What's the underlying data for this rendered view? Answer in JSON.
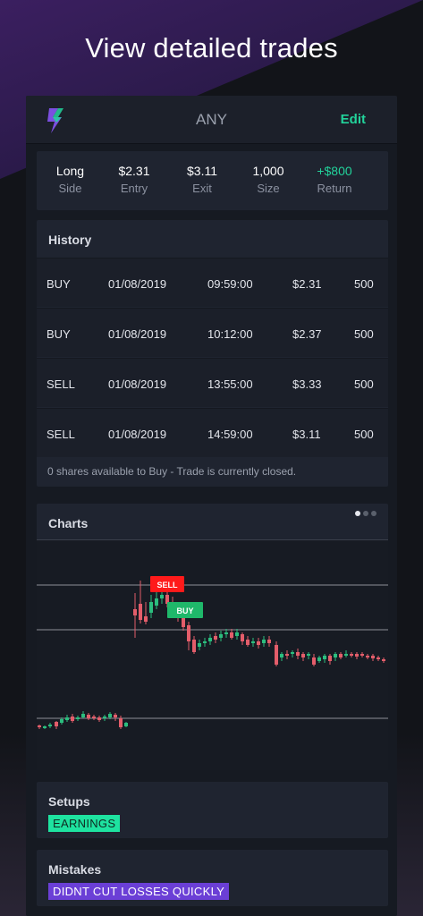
{
  "hero_title": "View detailed trades",
  "header": {
    "ticker": "ANY",
    "edit_label": "Edit"
  },
  "summary": [
    {
      "value": "Long",
      "label": "Side"
    },
    {
      "value": "$2.31",
      "label": "Entry"
    },
    {
      "value": "$3.11",
      "label": "Exit"
    },
    {
      "value": "1,000",
      "label": "Size"
    },
    {
      "value": "+$800",
      "label": "Return"
    }
  ],
  "history": {
    "title": "History",
    "rows": [
      {
        "side": "BUY",
        "date": "01/08/2019",
        "time": "09:59:00",
        "price": "$2.31",
        "qty": "500"
      },
      {
        "side": "BUY",
        "date": "01/08/2019",
        "time": "10:12:00",
        "price": "$2.37",
        "qty": "500"
      },
      {
        "side": "SELL",
        "date": "01/08/2019",
        "time": "13:55:00",
        "price": "$3.33",
        "qty": "500"
      },
      {
        "side": "SELL",
        "date": "01/08/2019",
        "time": "14:59:00",
        "price": "$3.11",
        "qty": "500"
      }
    ],
    "note": "0 shares available to Buy - Trade is currently closed."
  },
  "charts": {
    "title": "Charts",
    "sell_marker": "SELL",
    "buy_marker": "BUY"
  },
  "setups": {
    "title": "Setups",
    "tag": "EARNINGS"
  },
  "mistakes": {
    "title": "Mistakes",
    "tag": "DIDNT CUT LOSSES QUICKLY"
  },
  "colors": {
    "accent": "#22d39b",
    "up": "#2bbd7e",
    "down": "#e35d6a",
    "purple_tag": "#6b3fd6"
  }
}
